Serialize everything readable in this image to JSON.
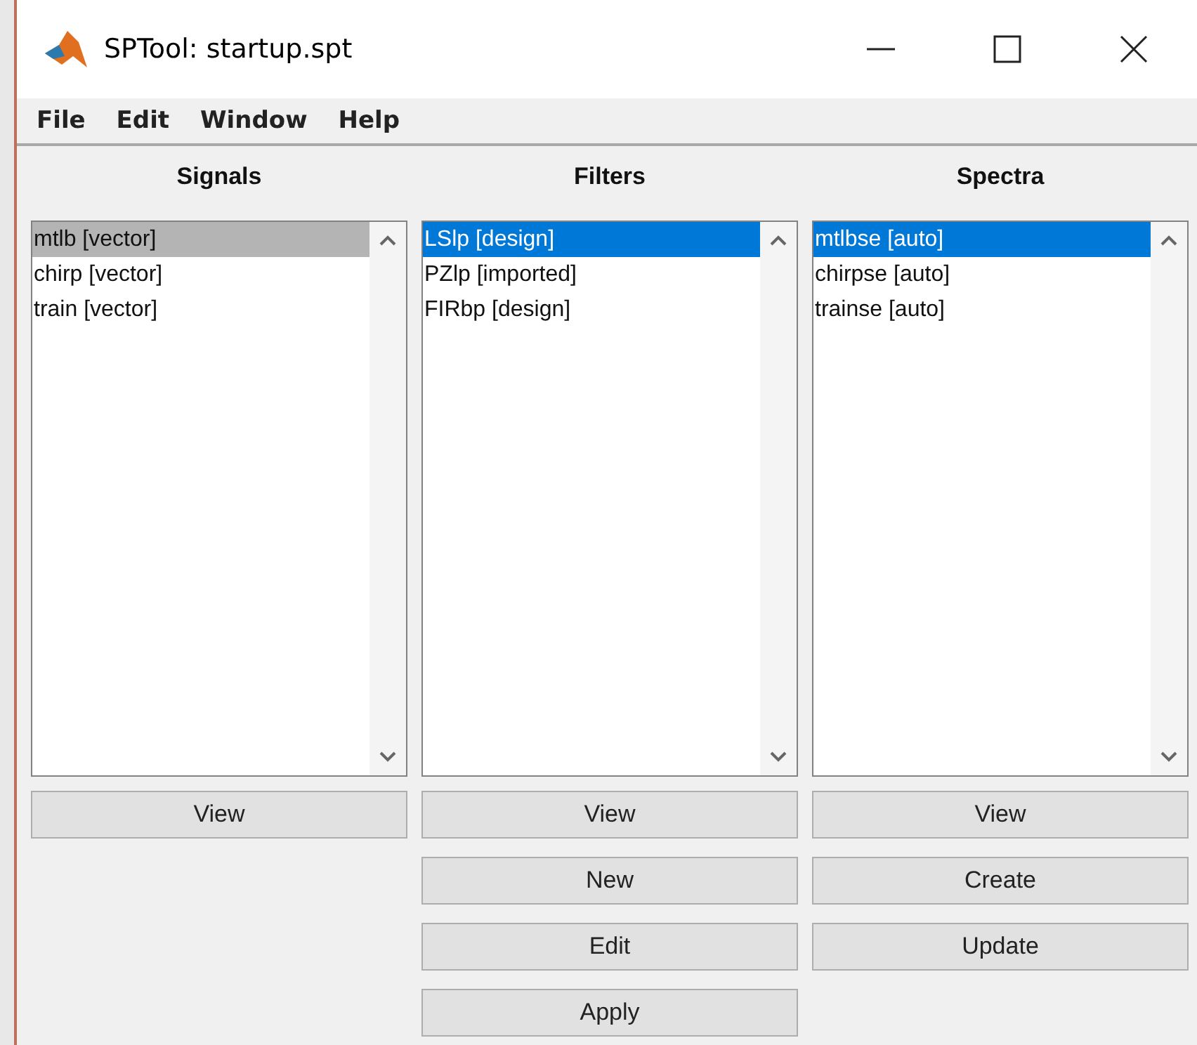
{
  "window": {
    "title": "SPTool: startup.spt"
  },
  "menu": [
    "File",
    "Edit",
    "Window",
    "Help"
  ],
  "panels": [
    {
      "title": "Signals",
      "focused": false,
      "items": [
        {
          "label": "mtlb [vector]",
          "selected": true
        },
        {
          "label": "chirp [vector]",
          "selected": false
        },
        {
          "label": "train [vector]",
          "selected": false
        }
      ],
      "buttons": [
        "View"
      ]
    },
    {
      "title": "Filters",
      "focused": true,
      "items": [
        {
          "label": "LSlp [design]",
          "selected": true
        },
        {
          "label": "PZlp [imported]",
          "selected": false
        },
        {
          "label": "FIRbp [design]",
          "selected": false
        }
      ],
      "buttons": [
        "View",
        "New",
        "Edit",
        "Apply"
      ]
    },
    {
      "title": "Spectra",
      "focused": true,
      "items": [
        {
          "label": "mtlbse [auto]",
          "selected": true
        },
        {
          "label": "chirpse [auto]",
          "selected": false
        },
        {
          "label": "trainse [auto]",
          "selected": false
        }
      ],
      "buttons": [
        "View",
        "Create",
        "Update"
      ]
    }
  ]
}
